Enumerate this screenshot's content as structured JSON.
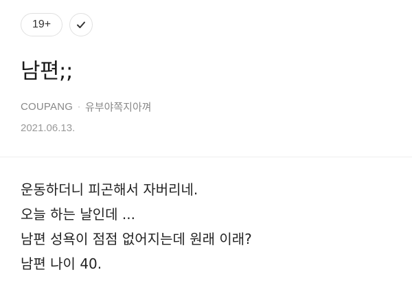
{
  "tags": {
    "age_badge": "19+"
  },
  "post": {
    "title": "남편;;",
    "source": "COUPANG",
    "author": "유부야쪽지아껴",
    "date": "2021.06.13.",
    "body_lines": [
      "운동하더니 피곤해서 자버리네.",
      "오늘 하는 날인데 ...",
      "남편 성욕이 점점 없어지는데 원래 이래?",
      "남편 나이 40."
    ]
  },
  "icons": {
    "check": "check-icon"
  },
  "colors": {
    "text": "#222222",
    "meta": "#888888",
    "border": "#e0e0e0"
  }
}
